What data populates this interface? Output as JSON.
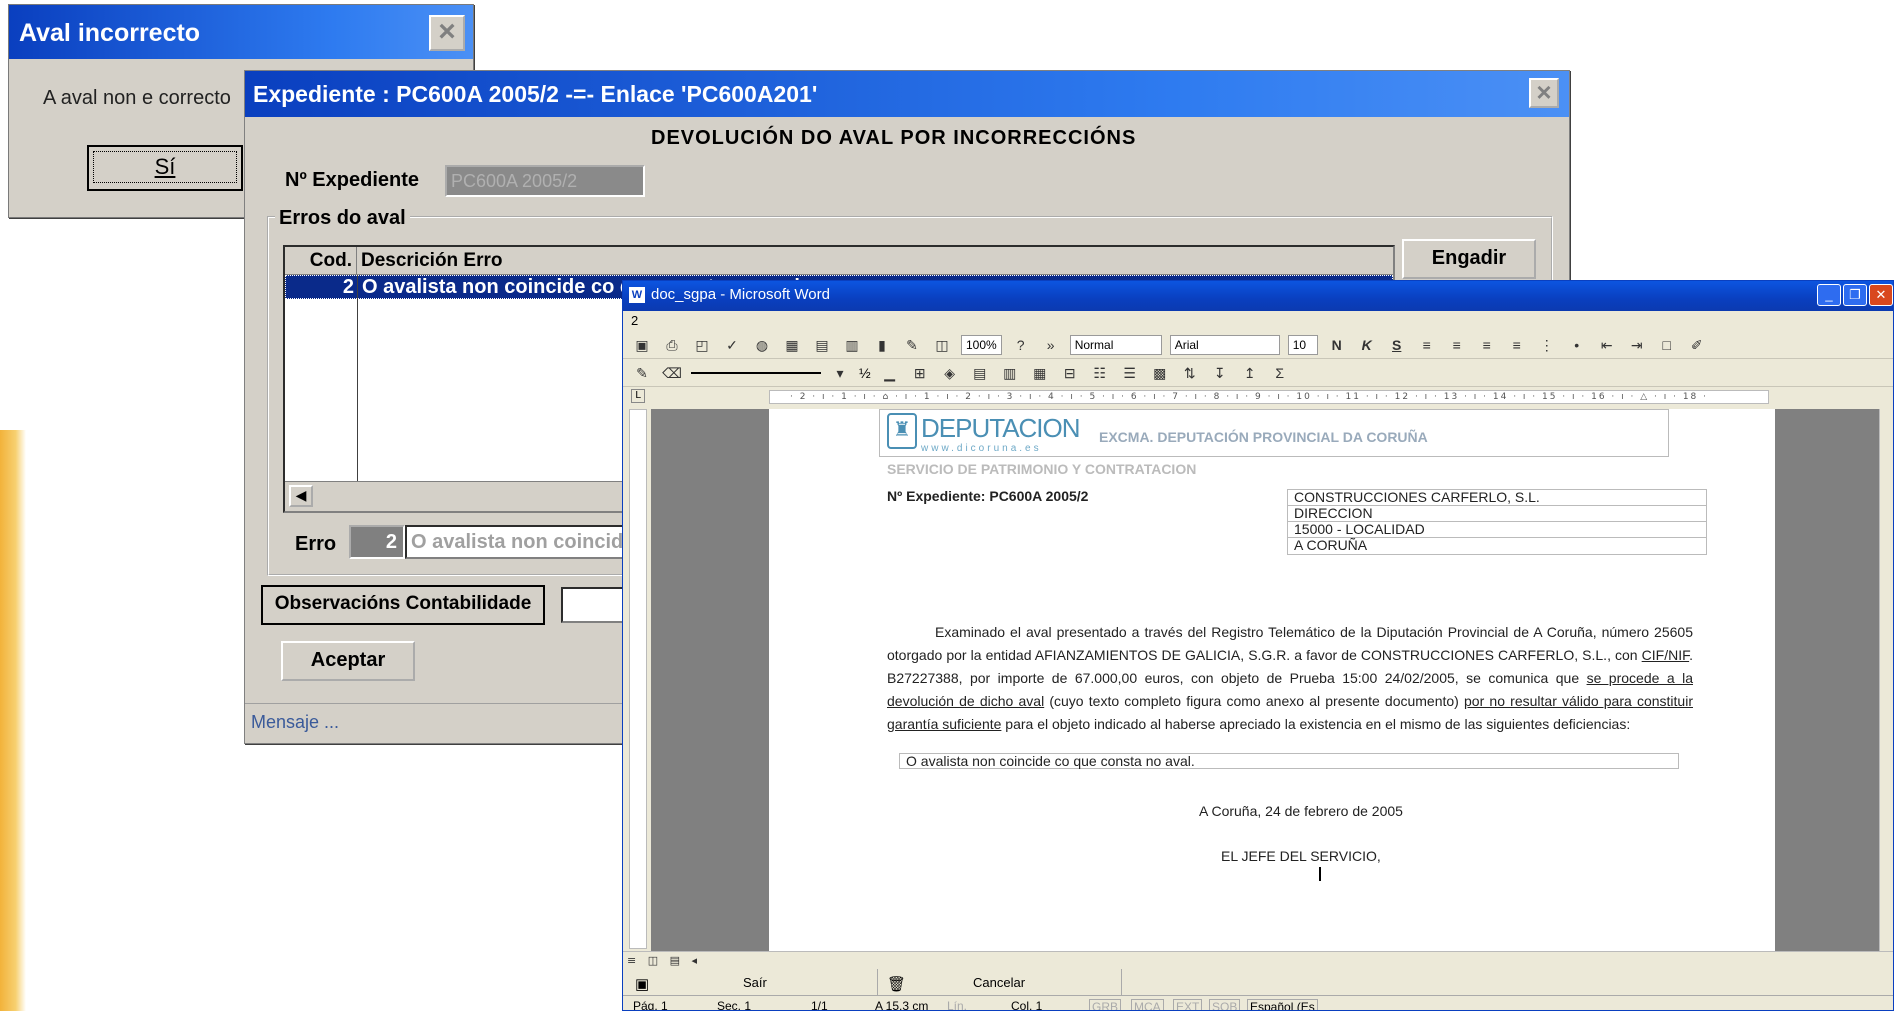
{
  "aval_dialog": {
    "title": "Aval incorrecto",
    "close": "×",
    "message": "A aval non e correcto",
    "yes_label": "Sí"
  },
  "exp_dialog": {
    "title": "Expediente : PC600A 2005/2  -=-  Enlace 'PC600A201'",
    "close": "×",
    "heading": "DEVOLUCIÓN DO AVAL POR INCORRECCIÓNS",
    "nexp_label": "Nº Expediente",
    "nexp_value": "PC600A 2005/2",
    "errs_legend": "Erros do aval",
    "grid": {
      "col_code": "Cod.",
      "col_desc": "Descrición Erro",
      "rows": [
        {
          "code": "2",
          "desc": "O avalista non coincide co que consta no aval."
        }
      ]
    },
    "add_label": "Engadir",
    "erro_label": "Erro",
    "erro_code": "2",
    "erro_desc": "O avalista non coincide co que consta no aval.",
    "obs_label": "Observacións Contabilidade",
    "accept_label": "Aceptar",
    "status": "Mensaje ..."
  },
  "word": {
    "title": "doc_sgpa - Microsoft Word",
    "menu_marker": "2",
    "zoom": "100%",
    "style": "Normal",
    "font": "Arial",
    "size": "10",
    "line_width": "½",
    "ruler_text": "· 2 · ı · 1 · ı · ⌂ · ı · 1 · ı · 2 · ı · 3 · ı · 4 · ı · 5 · ı · 6 · ı · 7 · ı · 8 · ı · 9 · ı · 10 · ı · 11 · ı · 12 · ı · 13 · ı · 14 · ı · 15 · ı · 16 · ı · △ · ı · 18 ·",
    "doc": {
      "logo_text": "DEPUTACION",
      "logo_url": "www.dicoruna.es",
      "org": "EXCMA. DEPUTACIÓN PROVINCIAL DA CORUÑA",
      "service": "SERVICIO DE PATRIMONIO Y CONTRATACION",
      "nexp": "Nº Expediente: PC600A 2005/2",
      "address": [
        "CONSTRUCCIONES CARFERLO, S.L.",
        "DIRECCION",
        "15000 - LOCALIDAD",
        "A CORUÑA"
      ],
      "p1": "Examinado el aval presentado a través del Registro Telemático de la Diputación Provincial de A Coruña, número 25605 otorgado por la entidad AFIANZAMIENTOS DE GALICIA, S.G.R. a favor de CONSTRUCCIONES CARFERLO, S.L., con ",
      "p_cif": "CIF/NIF",
      "p2": ". B27227388, por importe de 67.000,00 euros, con objeto de  Prueba 15:00 24/02/2005, se comunica que ",
      "p_u1": "se procede a la devolución de dicho aval",
      "p3": " (cuyo texto completo figura como anexo al presente documento) ",
      "p_u2": "por no resultar válido para constituir garantía suficiente",
      "p4": " para el objeto indicado al haberse apreciado la existencia en el mismo de las siguientes deficiencias:",
      "deficiency": "O avalista non coincide co que consta no aval.",
      "date": "A Coruña, 24 de febrero de 2005",
      "chief": "EL JEFE DEL SERVICIO,"
    },
    "form": {
      "exit_label": "Saír",
      "cancel_label": "Cancelar"
    },
    "status": {
      "page": "Pág. 1",
      "sec": "Sec. 1",
      "pages": "1/1",
      "at": "A 15,3 cm",
      "line": "Lín.",
      "col": "Col. 1",
      "grb": "GRB",
      "mca": "MCA",
      "ext": "EXT",
      "sob": "SOB",
      "lang": "Español (Es"
    }
  },
  "accent_color": "#f2b23a"
}
